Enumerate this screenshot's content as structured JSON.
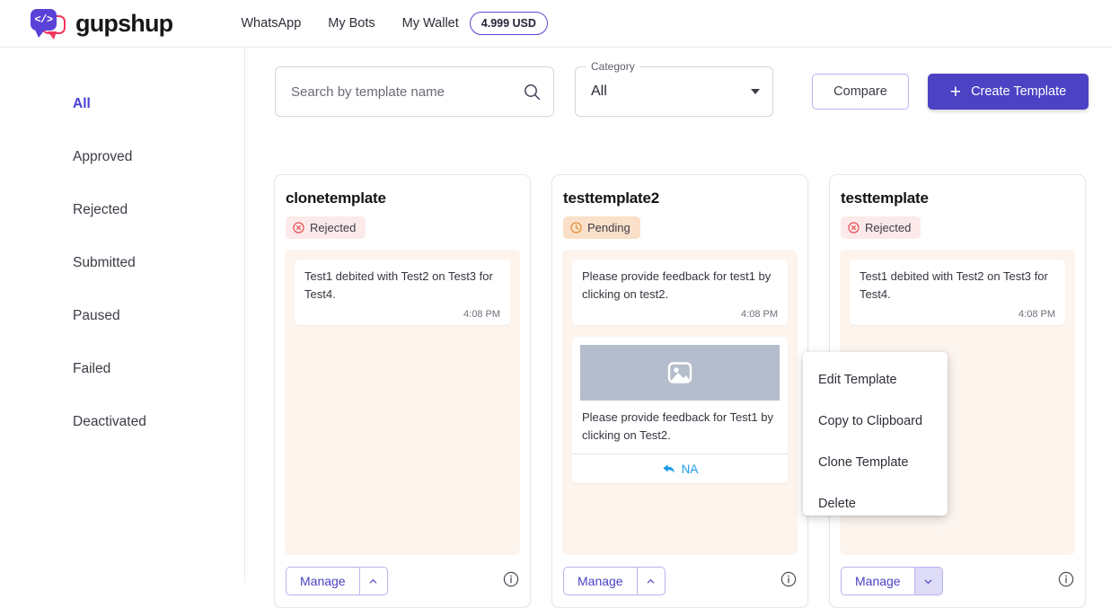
{
  "topnav": {
    "logo_text": "gupshup",
    "logo_glyph": "</>",
    "links": [
      {
        "label": "WhatsApp"
      },
      {
        "label": "My Bots"
      },
      {
        "label": "My Wallet"
      }
    ],
    "wallet_balance": "4.999 USD"
  },
  "sidebar": {
    "items": [
      {
        "label": "All",
        "active": true
      },
      {
        "label": "Approved",
        "active": false
      },
      {
        "label": "Rejected",
        "active": false
      },
      {
        "label": "Submitted",
        "active": false
      },
      {
        "label": "Paused",
        "active": false
      },
      {
        "label": "Failed",
        "active": false
      },
      {
        "label": "Deactivated",
        "active": false
      }
    ]
  },
  "toolbar": {
    "search_placeholder": "Search by template name",
    "search_value": "",
    "search_icon": "search-icon",
    "category_label": "Category",
    "category_value": "All",
    "compare_label": "Compare",
    "create_label": "Create Template",
    "create_icon": "plus-icon"
  },
  "cards": [
    {
      "title": "clonetemplate",
      "status": "Rejected",
      "status_kind": "rejected",
      "status_icon": "circle-x-icon",
      "messages": [
        {
          "text": "Test1 debited with Test2 on Test3 for Test4.",
          "time": "4:08 PM"
        }
      ],
      "media": null,
      "manage_label": "Manage",
      "caret_dir": "up",
      "caret_open": false,
      "info_icon": "info-icon"
    },
    {
      "title": "testtemplate2",
      "status": "Pending",
      "status_kind": "pending",
      "status_icon": "clock-icon",
      "messages": [
        {
          "text": "Please provide feedback for test1 by clicking on test2.",
          "time": "4:08 PM"
        }
      ],
      "media": {
        "placeholder_icon": "image-placeholder-icon",
        "text": "Please provide feedback for Test1 by clicking on Test2.",
        "reply_label": "NA",
        "reply_icon": "reply-arrow-icon"
      },
      "manage_label": "Manage",
      "caret_dir": "up",
      "caret_open": false,
      "info_icon": "info-icon"
    },
    {
      "title": "testtemplate",
      "status": "Rejected",
      "status_kind": "rejected",
      "status_icon": "circle-x-icon",
      "messages": [
        {
          "text": "Test1 debited with Test2 on Test3 for Test4.",
          "time": "4:08 PM"
        }
      ],
      "media": null,
      "manage_label": "Manage",
      "caret_dir": "down",
      "caret_open": true,
      "info_icon": "info-icon"
    }
  ],
  "menu": {
    "items": [
      {
        "label": "Edit Template"
      },
      {
        "label": "Copy to Clipboard"
      },
      {
        "label": "Clone Template"
      },
      {
        "label": "Delete"
      }
    ]
  },
  "colors": {
    "brand_purple": "#4b42c4",
    "accent_pink": "#f4365f",
    "rejected_bg": "#fce9e9",
    "rejected_fg": "#e8424a",
    "pending_bg": "#fae0c8",
    "pending_fg": "#e08a2c",
    "chat_bg": "#fdf4ee",
    "reply_blue": "#1b9ce8"
  }
}
